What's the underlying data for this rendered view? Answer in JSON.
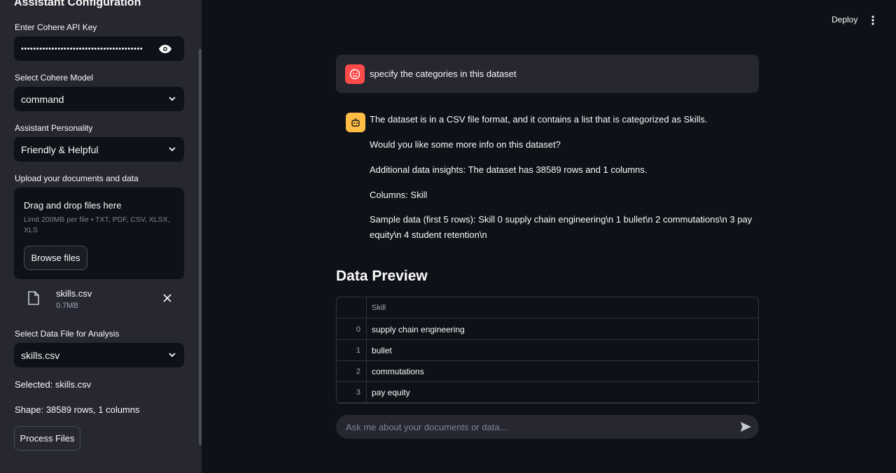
{
  "sidebar": {
    "title": "Assistant Configuration",
    "api_key_label": "Enter Cohere API Key",
    "api_key_value": "••••••••••••••••••••••••••••••••••••••••",
    "model_label": "Select Cohere Model",
    "model_value": "command",
    "personality_label": "Assistant Personality",
    "personality_value": "Friendly & Helpful",
    "upload_label": "Upload your documents and data",
    "upload": {
      "title": "Drag and drop files here",
      "limit": "Limit 200MB per file • TXT, PDF, CSV, XLSX, XLS",
      "browse_label": "Browse files"
    },
    "file": {
      "name": "skills.csv",
      "size": "0.7MB"
    },
    "data_file_label": "Select Data File for Analysis",
    "data_file_value": "skills.csv",
    "selected_text": "Selected: skills.csv",
    "shape_text": "Shape: 38589 rows, 1 columns",
    "process_label": "Process Files"
  },
  "header": {
    "deploy_label": "Deploy"
  },
  "chat": {
    "user_message": "specify the categories in this dataset",
    "assistant_lines": [
      "The dataset is in a CSV file format, and it contains a list that is categorized as Skills.",
      "Would you like some more info on this dataset?",
      "Additional data insights: The dataset has 38589 rows and 1 columns.",
      "Columns: Skill",
      "Sample data (first 5 rows): Skill 0 supply chain engineering\\n 1 bullet\\n 2 commutations\\n 3 pay equity\\n 4 student retention\\n"
    ],
    "input_placeholder": "Ask me about your documents or data..."
  },
  "preview": {
    "title": "Data Preview",
    "column_header": "Skill",
    "rows": [
      {
        "index": "0",
        "skill": "supply chain engineering"
      },
      {
        "index": "1",
        "skill": "bullet"
      },
      {
        "index": "2",
        "skill": "commutations"
      },
      {
        "index": "3",
        "skill": "pay equity"
      }
    ]
  },
  "colors": {
    "background": "#0e1117",
    "sidebar": "#262730",
    "user_avatar": "#ff4b4b",
    "bot_avatar": "#ffbd45"
  }
}
